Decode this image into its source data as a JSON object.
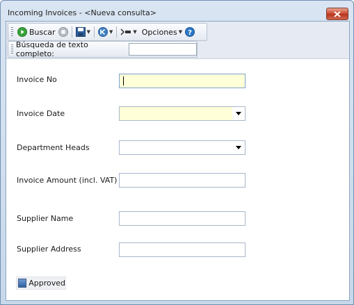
{
  "window": {
    "title": "Incoming Invoices - <Nueva consulta>"
  },
  "toolbar": {
    "search_label": "Buscar",
    "options_label": "Opciones",
    "full_text_label": "Búsqueda de texto completo:",
    "full_text_value": ""
  },
  "form": {
    "invoice_no_label": "Invoice No",
    "invoice_no_value": "",
    "invoice_date_label": "Invoice Date",
    "invoice_date_value": "",
    "department_heads_label": "Department Heads",
    "department_heads_value": "",
    "invoice_amount_label": "Invoice Amount (incl. VAT)",
    "invoice_amount_value": "",
    "supplier_name_label": "Supplier Name",
    "supplier_name_value": "",
    "supplier_address_label": "Supplier Address",
    "supplier_address_value": "",
    "approved_label": "Approved"
  },
  "colors": {
    "required_field": "#ffffd8",
    "play_icon": "#3aa23a",
    "help_icon": "#2b76c6"
  }
}
